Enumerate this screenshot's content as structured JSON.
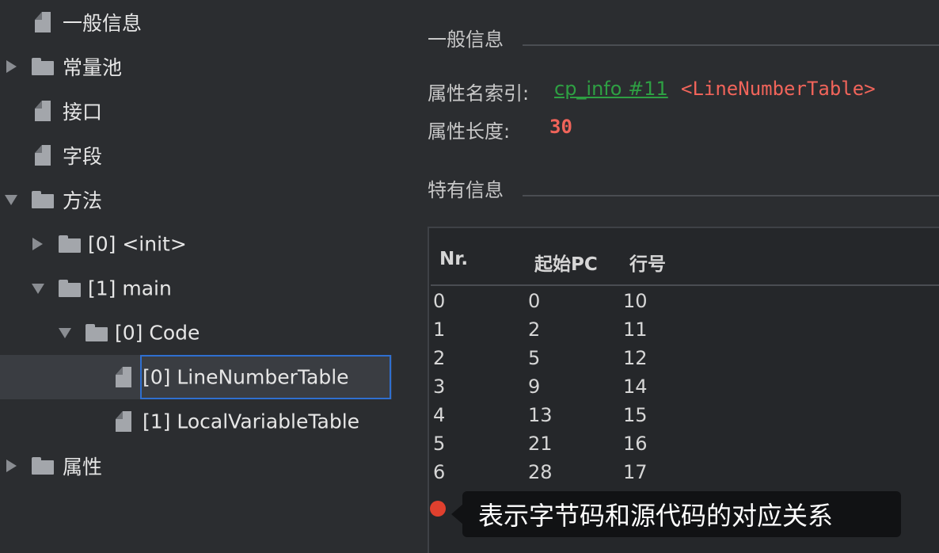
{
  "tree": {
    "items": [
      {
        "label": "一般信息",
        "kind": "file"
      },
      {
        "label": "常量池",
        "kind": "folder",
        "expanded": false
      },
      {
        "label": "接口",
        "kind": "file"
      },
      {
        "label": "字段",
        "kind": "file"
      },
      {
        "label": "方法",
        "kind": "folder",
        "expanded": true
      },
      {
        "label": "[0] <init>",
        "kind": "folder",
        "expanded": false
      },
      {
        "label": "[1] main",
        "kind": "folder",
        "expanded": true
      },
      {
        "label": "[0] Code",
        "kind": "folder",
        "expanded": true
      },
      {
        "label": "[0] LineNumberTable",
        "kind": "file",
        "selected": true
      },
      {
        "label": "[1] LocalVariableTable",
        "kind": "file"
      },
      {
        "label": "属性",
        "kind": "folder",
        "expanded": false
      }
    ]
  },
  "general": {
    "title": "一般信息",
    "name_index_label": "属性名索引:",
    "name_index_link": "cp_info #11",
    "name_index_value": "<LineNumberTable>",
    "length_label": "属性长度:",
    "length_value": "30"
  },
  "specific": {
    "title": "特有信息",
    "columns": [
      "Nr.",
      "起始PC",
      "行号"
    ],
    "rows": [
      [
        "0",
        "0",
        "10"
      ],
      [
        "1",
        "2",
        "11"
      ],
      [
        "2",
        "5",
        "12"
      ],
      [
        "3",
        "9",
        "14"
      ],
      [
        "4",
        "13",
        "15"
      ],
      [
        "5",
        "21",
        "16"
      ],
      [
        "6",
        "28",
        "17"
      ]
    ]
  },
  "annotation": {
    "text": "表示字节码和源代码的对应关系"
  },
  "colors": {
    "background": "#2b2d30",
    "link": "#2ea043",
    "accent_red": "#f0645a",
    "selection_border": "#2f6fd0",
    "dot": "#e0402e"
  }
}
